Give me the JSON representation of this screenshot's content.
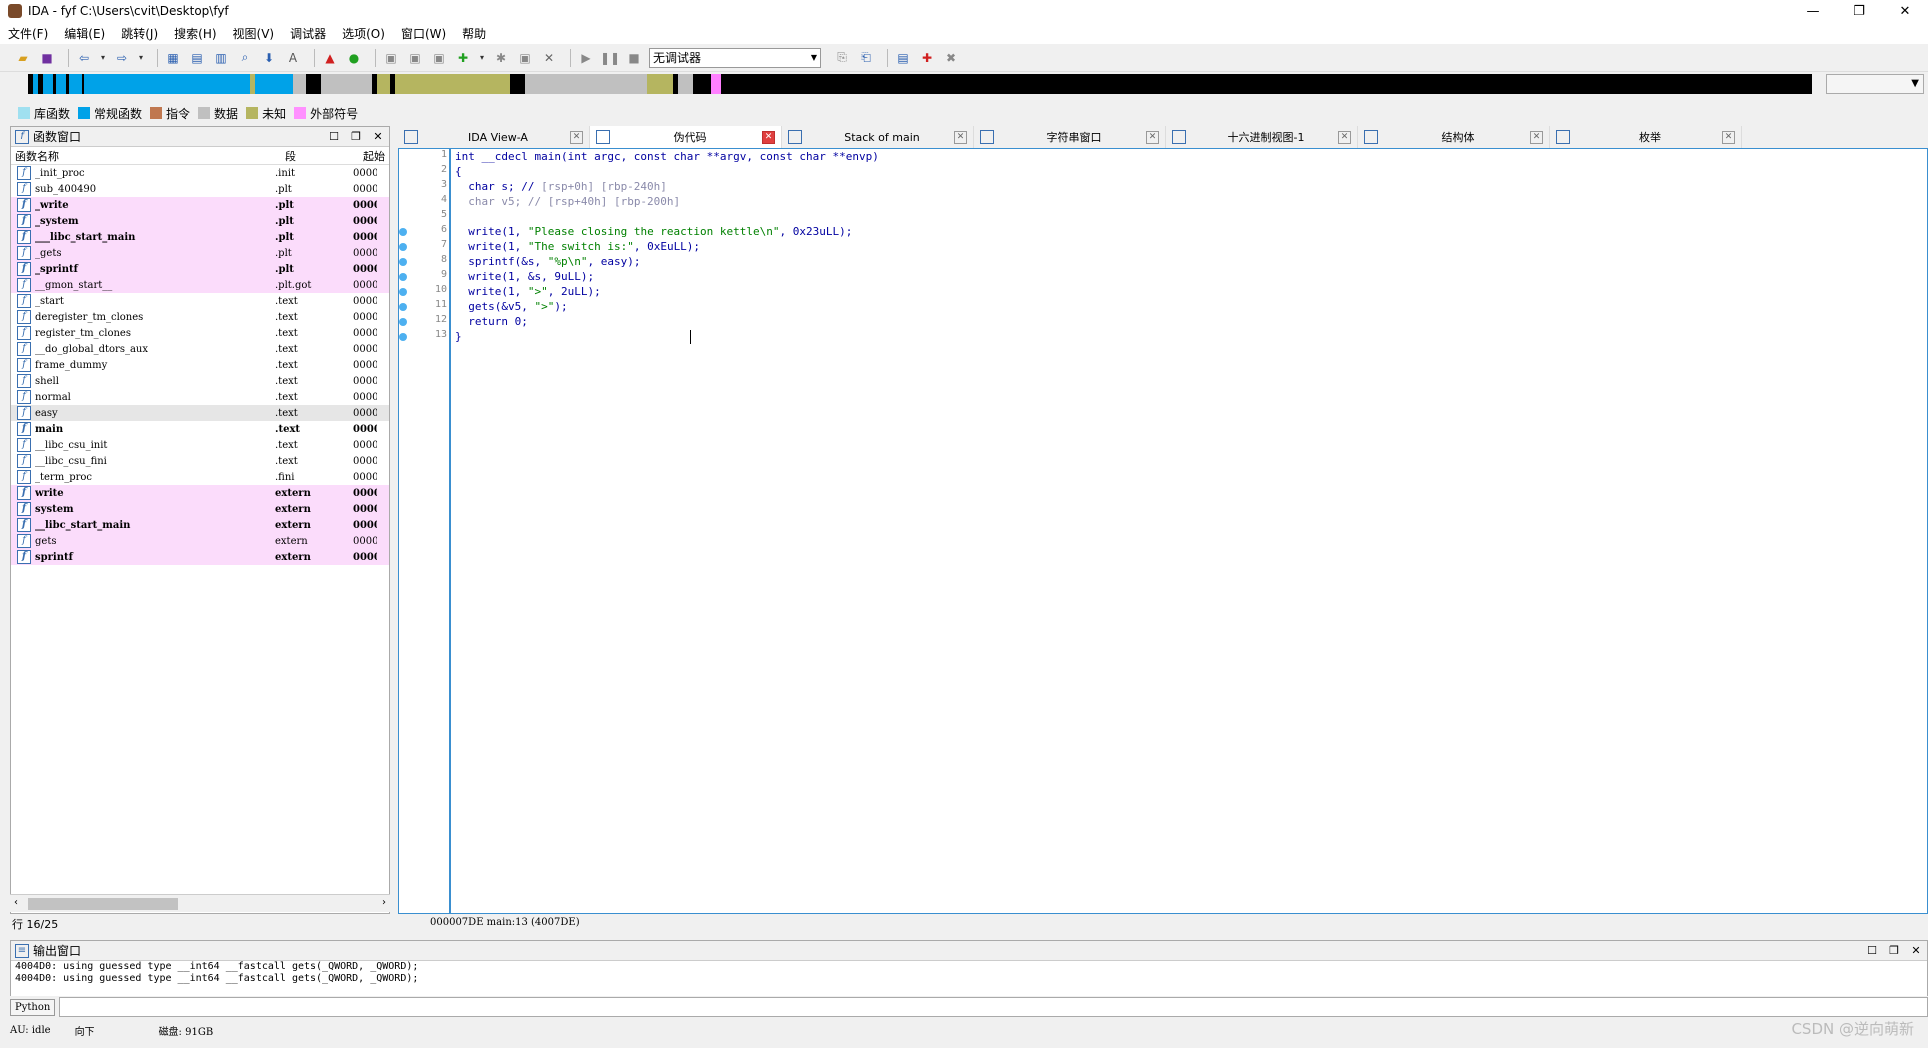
{
  "window": {
    "title": "IDA - fyf C:\\Users\\cvit\\Desktop\\fyf",
    "buttons": [
      "—",
      "❐",
      "✕"
    ]
  },
  "menu": [
    "文件(F)",
    "编辑(E)",
    "跳转(J)",
    "搜索(H)",
    "视图(V)",
    "调试器",
    "选项(O)",
    "窗口(W)",
    "帮助"
  ],
  "toolbar": {
    "debugger": "无调试器"
  },
  "nav_band": [
    {
      "color": "#000000",
      "w": 4
    },
    {
      "color": "#00a2e8",
      "w": 4
    },
    {
      "color": "#000000",
      "w": 4
    },
    {
      "color": "#00a2e8",
      "w": 8
    },
    {
      "color": "#000000",
      "w": 2
    },
    {
      "color": "#00a2e8",
      "w": 8
    },
    {
      "color": "#000000",
      "w": 2
    },
    {
      "color": "#00a2e8",
      "w": 10
    },
    {
      "color": "#000000",
      "w": 2
    },
    {
      "color": "#00a2e8",
      "w": 130
    },
    {
      "color": "#b5b560",
      "w": 4
    },
    {
      "color": "#00a2e8",
      "w": 30
    },
    {
      "color": "#c0c0c0",
      "w": 10
    },
    {
      "color": "#000000",
      "w": 12
    },
    {
      "color": "#c0c0c0",
      "w": 40
    },
    {
      "color": "#000000",
      "w": 4
    },
    {
      "color": "#b5b560",
      "w": 10
    },
    {
      "color": "#000000",
      "w": 4
    },
    {
      "color": "#b5b560",
      "w": 90
    },
    {
      "color": "#000000",
      "w": 12
    },
    {
      "color": "#c0c0c0",
      "w": 96
    },
    {
      "color": "#b5b560",
      "w": 20
    },
    {
      "color": "#000000",
      "w": 4
    },
    {
      "color": "#c0c0c0",
      "w": 12
    },
    {
      "color": "#000000",
      "w": 14
    },
    {
      "color": "#ff80ff",
      "w": 8
    },
    {
      "color": "#000000",
      "w": 856
    }
  ],
  "legend": [
    {
      "label": "库函数",
      "color": "#a0e0f0"
    },
    {
      "label": "常规函数",
      "color": "#00a2e8"
    },
    {
      "label": "指令",
      "color": "#c07850"
    },
    {
      "label": "数据",
      "color": "#c0c0c0"
    },
    {
      "label": "未知",
      "color": "#b5b560"
    },
    {
      "label": "外部符号",
      "color": "#ff90ff"
    }
  ],
  "func_panel": {
    "title": "函数窗口",
    "columns": [
      "函数名称",
      "段",
      "起始"
    ],
    "row_status": "行 16/25",
    "functions": [
      {
        "name": "_init_proc",
        "seg": ".init",
        "addr": "0000",
        "style": ""
      },
      {
        "name": "sub_400490",
        "seg": ".plt",
        "addr": "0000",
        "style": ""
      },
      {
        "name": "_write",
        "seg": ".plt",
        "addr": "0000",
        "style": "pink bold"
      },
      {
        "name": "_system",
        "seg": ".plt",
        "addr": "0000",
        "style": "pink bold"
      },
      {
        "name": "___libc_start_main",
        "seg": ".plt",
        "addr": "0000",
        "style": "pink bold"
      },
      {
        "name": "_gets",
        "seg": ".plt",
        "addr": "0000",
        "style": "pink"
      },
      {
        "name": "_sprintf",
        "seg": ".plt",
        "addr": "0000",
        "style": "pink bold"
      },
      {
        "name": "__gmon_start__",
        "seg": ".plt.got",
        "addr": "0000",
        "style": "pink"
      },
      {
        "name": "_start",
        "seg": ".text",
        "addr": "0000",
        "style": ""
      },
      {
        "name": "deregister_tm_clones",
        "seg": ".text",
        "addr": "0000",
        "style": ""
      },
      {
        "name": "register_tm_clones",
        "seg": ".text",
        "addr": "0000",
        "style": ""
      },
      {
        "name": "__do_global_dtors_aux",
        "seg": ".text",
        "addr": "0000",
        "style": ""
      },
      {
        "name": "frame_dummy",
        "seg": ".text",
        "addr": "0000",
        "style": ""
      },
      {
        "name": "shell",
        "seg": ".text",
        "addr": "0000",
        "style": ""
      },
      {
        "name": "normal",
        "seg": ".text",
        "addr": "0000",
        "style": ""
      },
      {
        "name": "easy",
        "seg": ".text",
        "addr": "0000",
        "style": "sel"
      },
      {
        "name": "main",
        "seg": ".text",
        "addr": "0000",
        "style": "bold"
      },
      {
        "name": "__libc_csu_init",
        "seg": ".text",
        "addr": "0000",
        "style": ""
      },
      {
        "name": "__libc_csu_fini",
        "seg": ".text",
        "addr": "0000",
        "style": ""
      },
      {
        "name": "_term_proc",
        "seg": ".fini",
        "addr": "0000",
        "style": ""
      },
      {
        "name": "write",
        "seg": "extern",
        "addr": "0000",
        "style": "pink bold"
      },
      {
        "name": "system",
        "seg": "extern",
        "addr": "0000",
        "style": "pink bold"
      },
      {
        "name": "__libc_start_main",
        "seg": "extern",
        "addr": "0000",
        "style": "pink bold"
      },
      {
        "name": "gets",
        "seg": "extern",
        "addr": "0000",
        "style": "pink"
      },
      {
        "name": "sprintf",
        "seg": "extern",
        "addr": "0000",
        "style": "pink bold"
      }
    ]
  },
  "tabs": [
    {
      "label": "IDA View-A",
      "active": false
    },
    {
      "label": "伪代码",
      "active": true
    },
    {
      "label": "Stack of main",
      "active": false
    },
    {
      "label": "字符串窗口",
      "active": false
    },
    {
      "label": "十六进制视图-1",
      "active": false
    },
    {
      "label": "结构体",
      "active": false
    },
    {
      "label": "枚举",
      "active": false
    }
  ],
  "code": {
    "lines": [
      {
        "n": "1",
        "bp": false,
        "html": "int __cdecl main(int argc, const char **argv, const char **envp)"
      },
      {
        "n": "2",
        "bp": false,
        "html": "{"
      },
      {
        "n": "3",
        "bp": false,
        "html": "  char s; // <span class=\"cmt\">[rsp+0h] [rbp-240h]</span>"
      },
      {
        "n": "4",
        "bp": false,
        "html": "  <span class=\"cmt\">char v5; // [rsp+40h] [rbp-200h]</span>"
      },
      {
        "n": "5",
        "bp": false,
        "html": ""
      },
      {
        "n": "6",
        "bp": true,
        "html": "  write(1, <span class=\"str\">\"Please closing the reaction kettle\\n\"</span>, 0x23uLL);"
      },
      {
        "n": "7",
        "bp": true,
        "html": "  write(1, <span class=\"str\">\"The switch is:\"</span>, 0xEuLL);"
      },
      {
        "n": "8",
        "bp": true,
        "html": "  sprintf(&s, <span class=\"str\">\"%p\\n\"</span>, easy);"
      },
      {
        "n": "9",
        "bp": true,
        "html": "  write(1, &s, 9uLL);"
      },
      {
        "n": "10",
        "bp": true,
        "html": "  write(1, <span class=\"str\">\">\"</span>, 2uLL);"
      },
      {
        "n": "11",
        "bp": true,
        "html": "  gets(&v5, <span class=\"str\">\">\"</span>);"
      },
      {
        "n": "12",
        "bp": true,
        "html": "  return 0;"
      },
      {
        "n": "13",
        "bp": true,
        "html": "}"
      }
    ],
    "addr_status": "000007DE main:13 (4007DE)"
  },
  "output": {
    "title": "输出窗口",
    "lines": [
      "4004D0: using guessed type __int64 __fastcall gets(_QWORD, _QWORD);",
      "4004D0: using guessed type __int64 __fastcall gets(_QWORD, _QWORD);"
    ],
    "python_button": "Python"
  },
  "status": {
    "au": "AU:  idle",
    "dir": "向下",
    "disk": "磁盘: 91GB"
  },
  "watermark": "CSDN @逆向萌新"
}
